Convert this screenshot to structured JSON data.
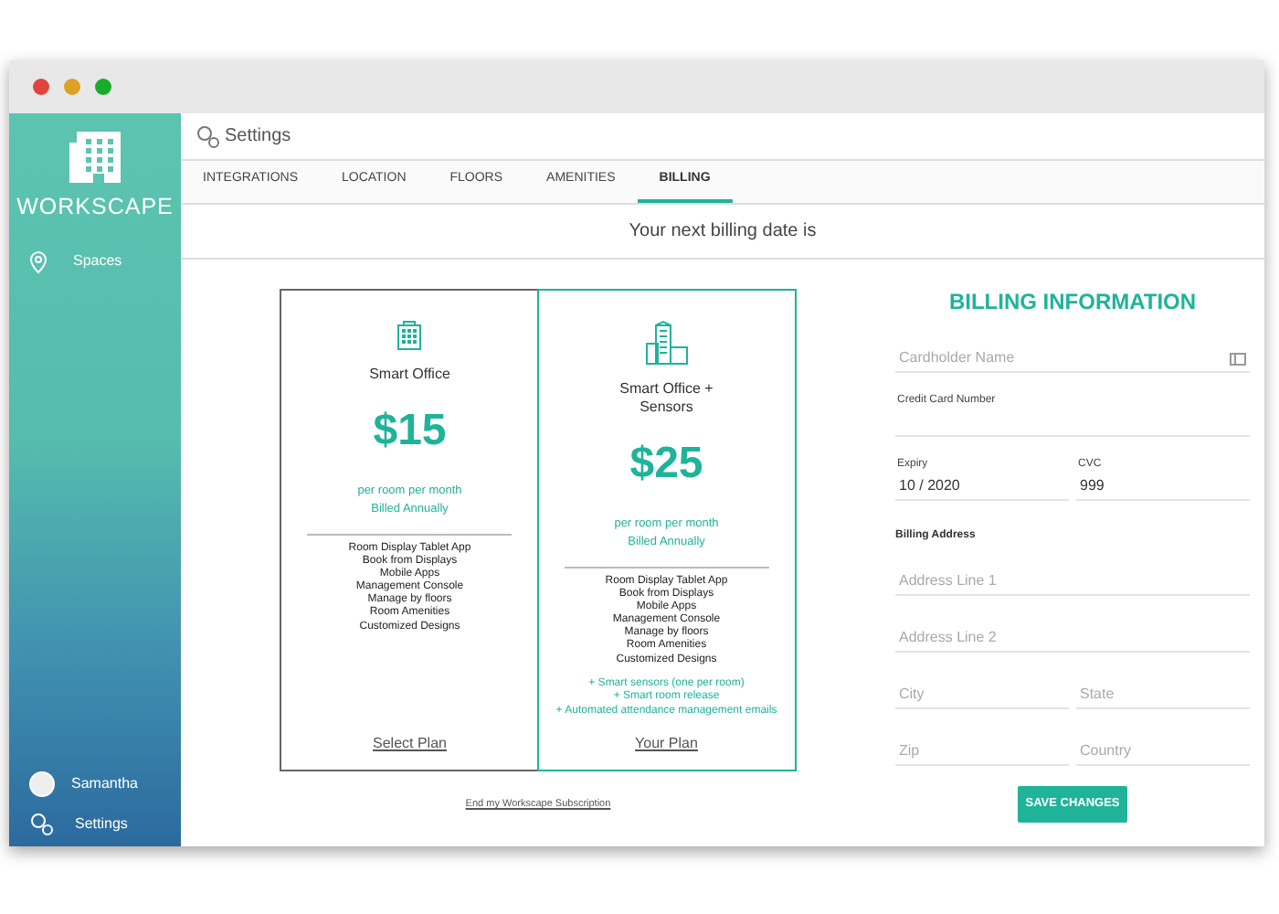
{
  "sidebar": {
    "brand": "WORKSCAPE",
    "items": [
      {
        "label": "Spaces"
      }
    ],
    "user": "Samantha",
    "settings": "Settings"
  },
  "header": {
    "title": "Settings"
  },
  "tabs": [
    {
      "label": "INTEGRATIONS",
      "selected": false
    },
    {
      "label": "LOCATION",
      "selected": false
    },
    {
      "label": "FLOORS",
      "selected": false
    },
    {
      "label": "AMENITIES",
      "selected": false
    },
    {
      "label": "BILLING",
      "selected": true
    }
  ],
  "billing_notice": "Your next billing date is",
  "plans": [
    {
      "kind": "office",
      "name": "Smart Office",
      "price": "$15",
      "period": "per room per month",
      "billing": "Billed Annually",
      "features": [
        "Room Display Tablet App",
        "Book from Displays",
        "Mobile Apps",
        "Management Console",
        "Manage by floors",
        "Room Amenities",
        "Customized Designs"
      ],
      "action": "Select Plan",
      "selected": false
    },
    {
      "kind": "office-sensors",
      "name": "Smart Office +\nSensors",
      "price": "$25",
      "period": "per room per month",
      "billing": "Billed Annually",
      "features": [
        "Room Display Tablet App",
        "Book from Displays",
        "Mobile Apps",
        "Management Console",
        "Manage by floors",
        "Room Amenities",
        "Customized Designs"
      ],
      "extras": [
        "+ Smart sensors (one per room)",
        "+ Smart room release",
        "+ Automated attendance management emails"
      ],
      "action": "Your Plan",
      "selected": true
    }
  ],
  "end_link": "End my Workscape Subscription",
  "billing_form": {
    "title": "BILLING INFORMATION",
    "rows": [
      [
        {
          "placeholder": "Cardholder Name",
          "card_icon": true
        }
      ],
      [
        {
          "label": "Credit Card Number"
        }
      ],
      [
        {
          "label": "Expiry",
          "value": "10 / 2020"
        },
        {
          "label": "CVC",
          "value": "999"
        }
      ],
      [
        {
          "kind": "section",
          "label": "Billing Address"
        }
      ],
      [
        {
          "placeholder": "Address Line 1"
        }
      ],
      [
        {
          "placeholder": "Address Line 2"
        }
      ],
      [
        {
          "placeholder": "City"
        },
        {
          "placeholder": "State"
        }
      ],
      [
        {
          "placeholder": "Zip"
        },
        {
          "placeholder": "Country"
        }
      ]
    ],
    "button": "SAVE CHANGES"
  }
}
